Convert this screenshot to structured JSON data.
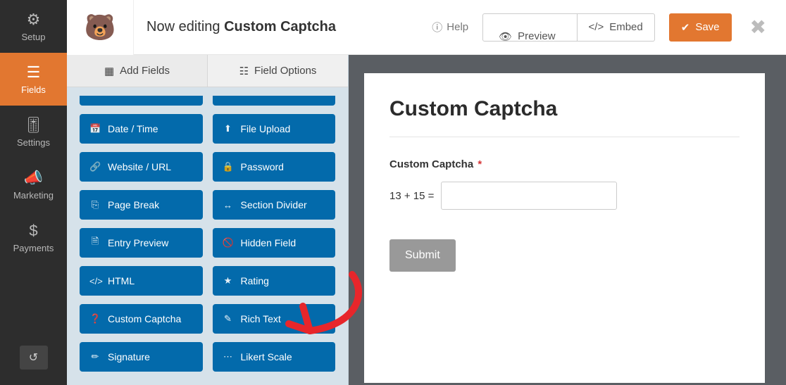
{
  "header": {
    "editing_prefix": "Now editing ",
    "editing_name": "Custom Captcha",
    "help": "Help",
    "preview": "Preview",
    "embed": "Embed",
    "save": "Save"
  },
  "leftnav": {
    "setup": "Setup",
    "fields": "Fields",
    "settings": "Settings",
    "marketing": "Marketing",
    "payments": "Payments"
  },
  "side_tabs": {
    "add": "Add Fields",
    "options": "Field Options"
  },
  "fields": {
    "date_time": "Date / Time",
    "file_upload": "File Upload",
    "website_url": "Website / URL",
    "password": "Password",
    "page_break": "Page Break",
    "section_divider": "Section Divider",
    "entry_preview": "Entry Preview",
    "hidden_field": "Hidden Field",
    "html": "HTML",
    "rating": "Rating",
    "custom_captcha": "Custom Captcha",
    "rich_text": "Rich Text",
    "signature": "Signature",
    "likert": "Likert Scale"
  },
  "form": {
    "title": "Custom Captcha",
    "field_label": "Custom Captcha",
    "required_mark": "*",
    "question": "13 + 15 =",
    "submit": "Submit"
  }
}
